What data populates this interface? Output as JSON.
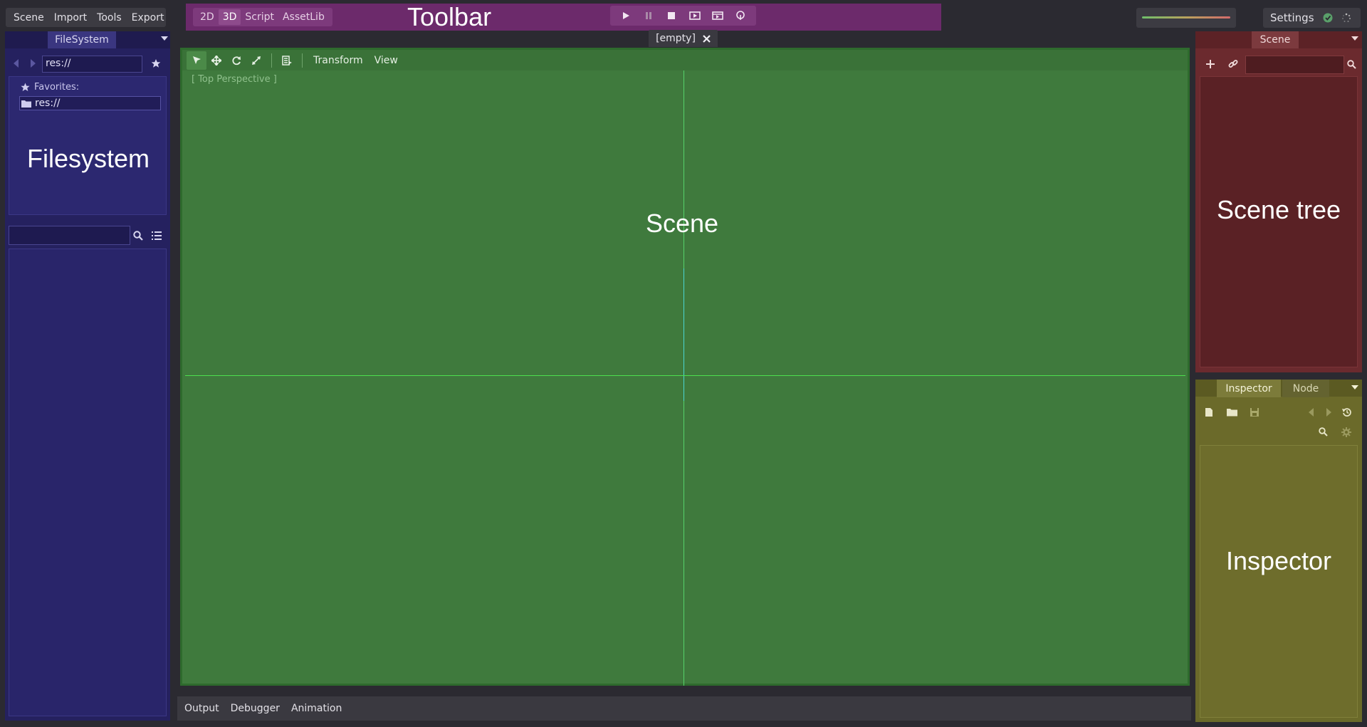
{
  "menu": {
    "items": [
      "Scene",
      "Import",
      "Tools",
      "Export"
    ]
  },
  "toolbar": {
    "workspace_tabs": [
      "2D",
      "3D",
      "Script",
      "AssetLib"
    ],
    "active_tab": "3D",
    "region_label": "Toolbar",
    "play_icons": [
      "play-icon",
      "pause-icon",
      "stop-icon",
      "play-scene-icon",
      "play-custom-scene-icon",
      "remote-debug-icon"
    ]
  },
  "settings": {
    "label": "Settings"
  },
  "filesystem": {
    "tab_label": "FileSystem",
    "path": "res://",
    "favorites_label": "Favorites:",
    "root_item": "res://",
    "region_label": "Filesystem",
    "search_placeholder": ""
  },
  "scene_tab": {
    "label": "[empty]"
  },
  "viewport": {
    "menus": [
      "Transform",
      "View"
    ],
    "perspective_label": "[ Top Perspective ]",
    "region_label": "Scene"
  },
  "bottom_panel": {
    "items": [
      "Output",
      "Debugger",
      "Animation"
    ]
  },
  "scene_tree": {
    "tab_label": "Scene",
    "filter_placeholder": "",
    "region_label": "Scene tree"
  },
  "inspector": {
    "tabs": [
      "Inspector",
      "Node"
    ],
    "active_tab": "Inspector",
    "region_label": "Inspector"
  },
  "colors": {
    "toolbar": "#6c2a6b",
    "filesystem": "#25215f",
    "viewport": "#3f7a3d",
    "scene_tree": "#6b2a2e",
    "inspector": "#6b6a2a"
  }
}
